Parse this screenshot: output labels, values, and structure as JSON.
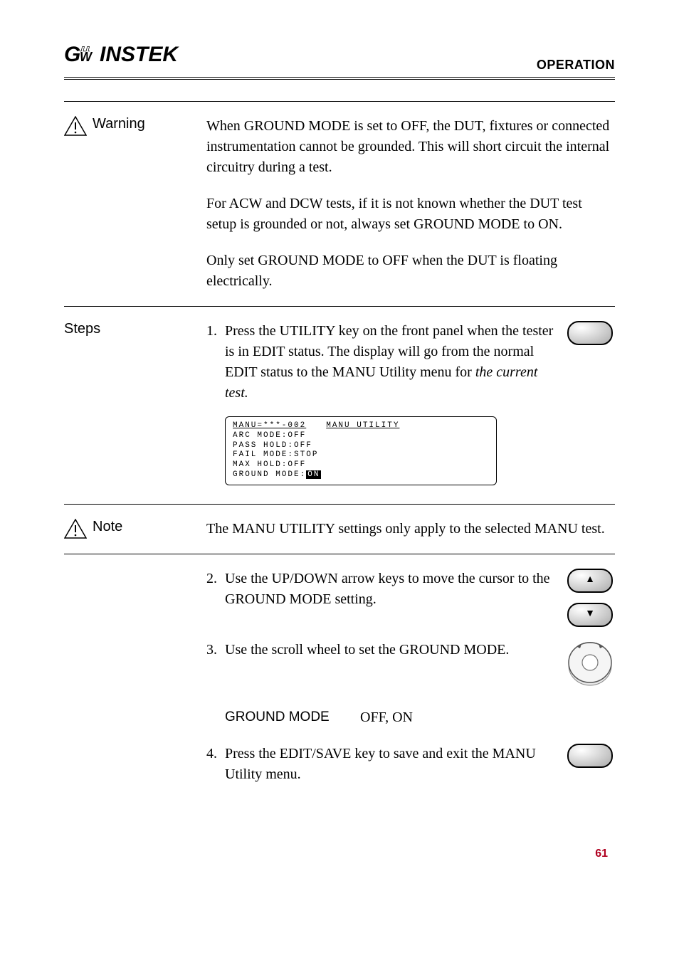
{
  "header": {
    "logo_text": "GWINSTEK",
    "right": "OPERATION"
  },
  "warning": {
    "label": "Warning",
    "para1": "When GROUND MODE is set to OFF, the DUT, fixtures or connected instrumentation cannot be grounded. This will short circuit the internal circuitry during a test.",
    "para2": "For ACW and DCW tests, if it is not known whether the DUT test setup is grounded or not, always set GROUND MODE to ON.",
    "para3": "Only set GROUND MODE to OFF when the DUT is floating electrically."
  },
  "steps": {
    "label": "Steps",
    "s1_num": "1.",
    "s1_text_a": "Press the UTILITY key on the front panel when the tester is in EDIT status. The display will go from the normal EDIT status to the MANU Utility menu for ",
    "s1_text_b": "the current test.",
    "display": {
      "title_a": "MANU=***-002",
      "title_b": "MANU UTILITY",
      "l1": "ARC  MODE:OFF",
      "l2": "PASS HOLD:OFF",
      "l3": "FAIL MODE:STOP",
      "l4": "MAX  HOLD:OFF",
      "l5a": "GROUND MODE:",
      "l5b": "ON"
    }
  },
  "note": {
    "label": "Note",
    "text": "The MANU UTILITY settings only apply to the selected MANU test."
  },
  "steps2": {
    "s2_num": "2.",
    "s2_text": "Use the UP/DOWN arrow keys to move the cursor to the GROUND MODE setting.",
    "s3_num": "3.",
    "s3_text": "Use the scroll wheel to set the GROUND MODE.",
    "gmode_label": "GROUND MODE",
    "gmode_val": "OFF, ON",
    "s4_num": "4.",
    "s4_text": "Press the EDIT/SAVE key to save and exit the MANU Utility menu."
  },
  "footer": {
    "page": "61"
  },
  "icons": {
    "up": "▲",
    "down": "▼"
  }
}
